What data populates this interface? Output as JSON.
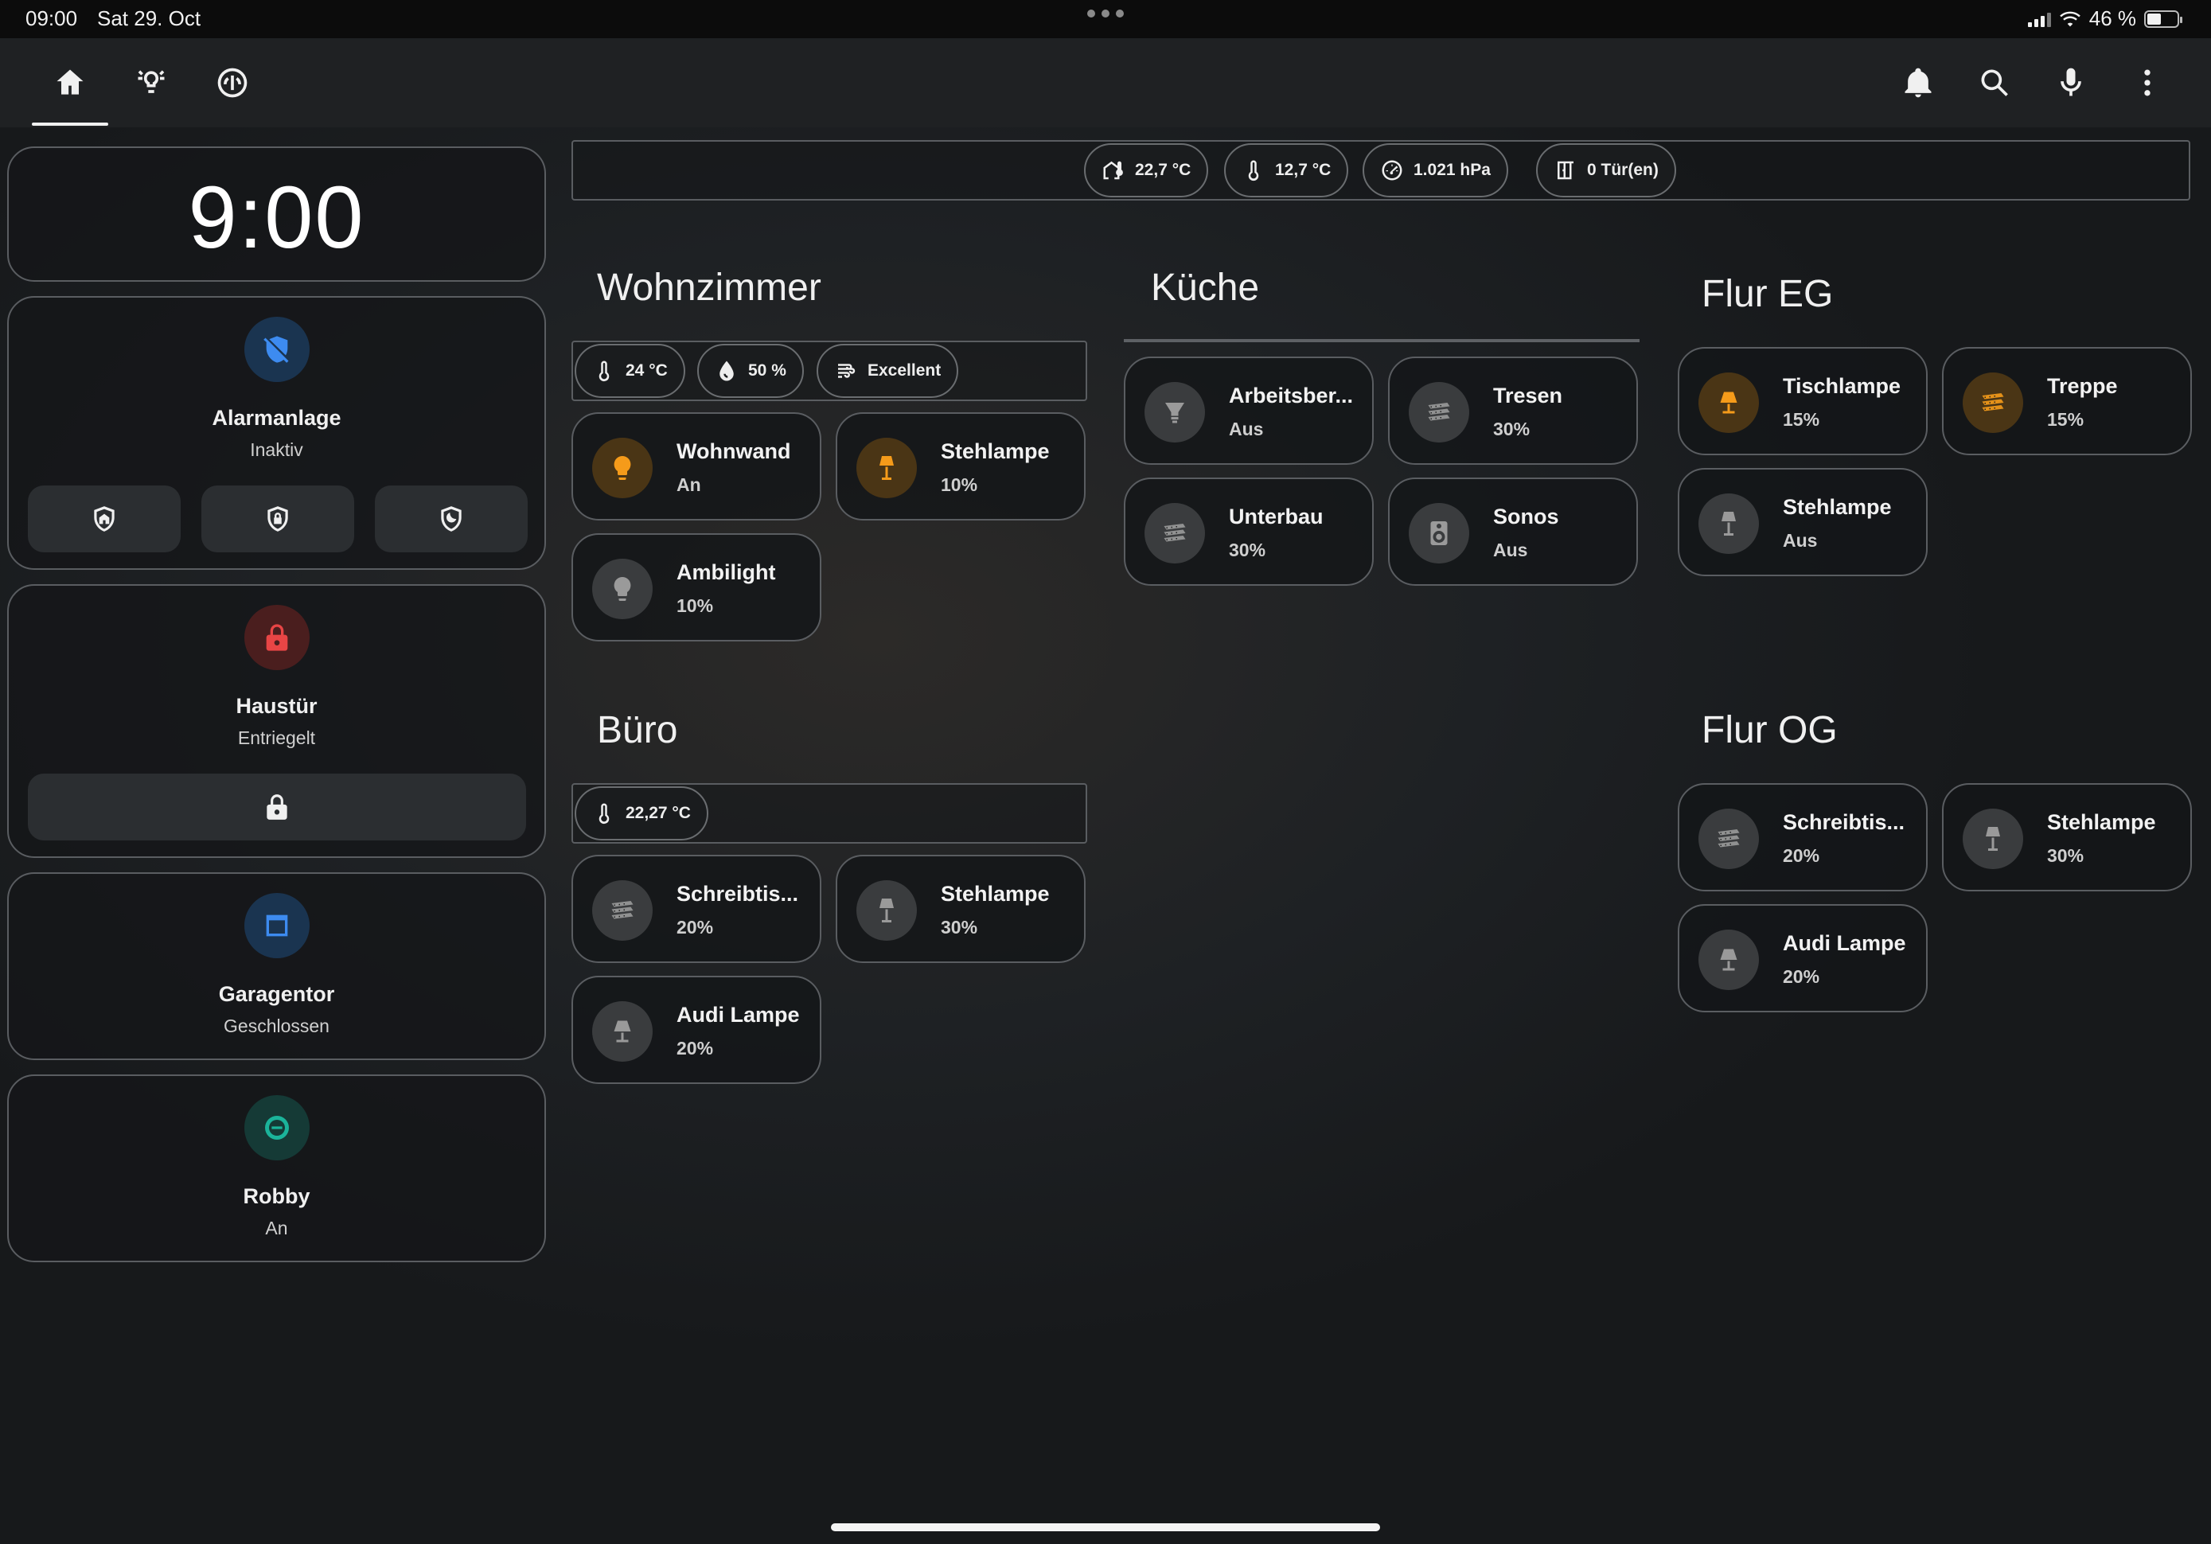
{
  "status_bar": {
    "time": "09:00",
    "date": "Sat 29. Oct",
    "battery": "46 %",
    "battery_level": 0.46
  },
  "left": {
    "clock": "9:00",
    "alarm": {
      "name": "Alarmanlage",
      "state": "Inaktiv",
      "color": "#2f80ed"
    },
    "door": {
      "name": "Haustür",
      "state": "Entriegelt",
      "color": "#e04040"
    },
    "garage": {
      "name": "Garagentor",
      "state": "Geschlossen",
      "color": "#2f80ed"
    },
    "robot": {
      "name": "Robby",
      "state": "An",
      "color": "#1bb39a"
    }
  },
  "header_chips": {
    "indoor_temp": "22,7 °C",
    "outdoor_temp": "12,7 °C",
    "pressure": "1.021 hPa",
    "doors": "0 Tür(en)"
  },
  "wohnzimmer": {
    "title": "Wohnzimmer",
    "chips": {
      "temp": "24 °C",
      "humidity": "50 %",
      "air": "Excellent"
    },
    "tiles": [
      {
        "name": "Wohnwand",
        "state": "An"
      },
      {
        "name": "Stehlampe",
        "state": "10%"
      },
      {
        "name": "Ambilight",
        "state": "10%"
      }
    ]
  },
  "buero": {
    "title": "Büro",
    "chips": {
      "temp": "22,27 °C"
    },
    "tiles": [
      {
        "name": "Schreibtis...",
        "state": "20%"
      },
      {
        "name": "Stehlampe",
        "state": "30%"
      },
      {
        "name": "Audi Lampe",
        "state": "20%"
      }
    ]
  },
  "kueche": {
    "title": "Küche",
    "tiles": [
      {
        "name": "Arbeitsber...",
        "state": "Aus"
      },
      {
        "name": "Tresen",
        "state": "30%"
      },
      {
        "name": "Unterbau",
        "state": "30%"
      },
      {
        "name": "Sonos",
        "state": "Aus"
      }
    ]
  },
  "flur_eg": {
    "title": "Flur EG",
    "tiles": [
      {
        "name": "Tischlampe",
        "state": "15%"
      },
      {
        "name": "Treppe",
        "state": "15%"
      },
      {
        "name": "Stehlampe",
        "state": "Aus"
      }
    ]
  },
  "flur_og": {
    "title": "Flur OG",
    "tiles": [
      {
        "name": "Schreibtis...",
        "state": "20%"
      },
      {
        "name": "Stehlampe",
        "state": "30%"
      },
      {
        "name": "Audi Lampe",
        "state": "20%"
      }
    ]
  },
  "colors": {
    "accent_on": "#f59b1a",
    "tile_icon_bg": "#3a3c3e",
    "border": "#5a5d61"
  }
}
